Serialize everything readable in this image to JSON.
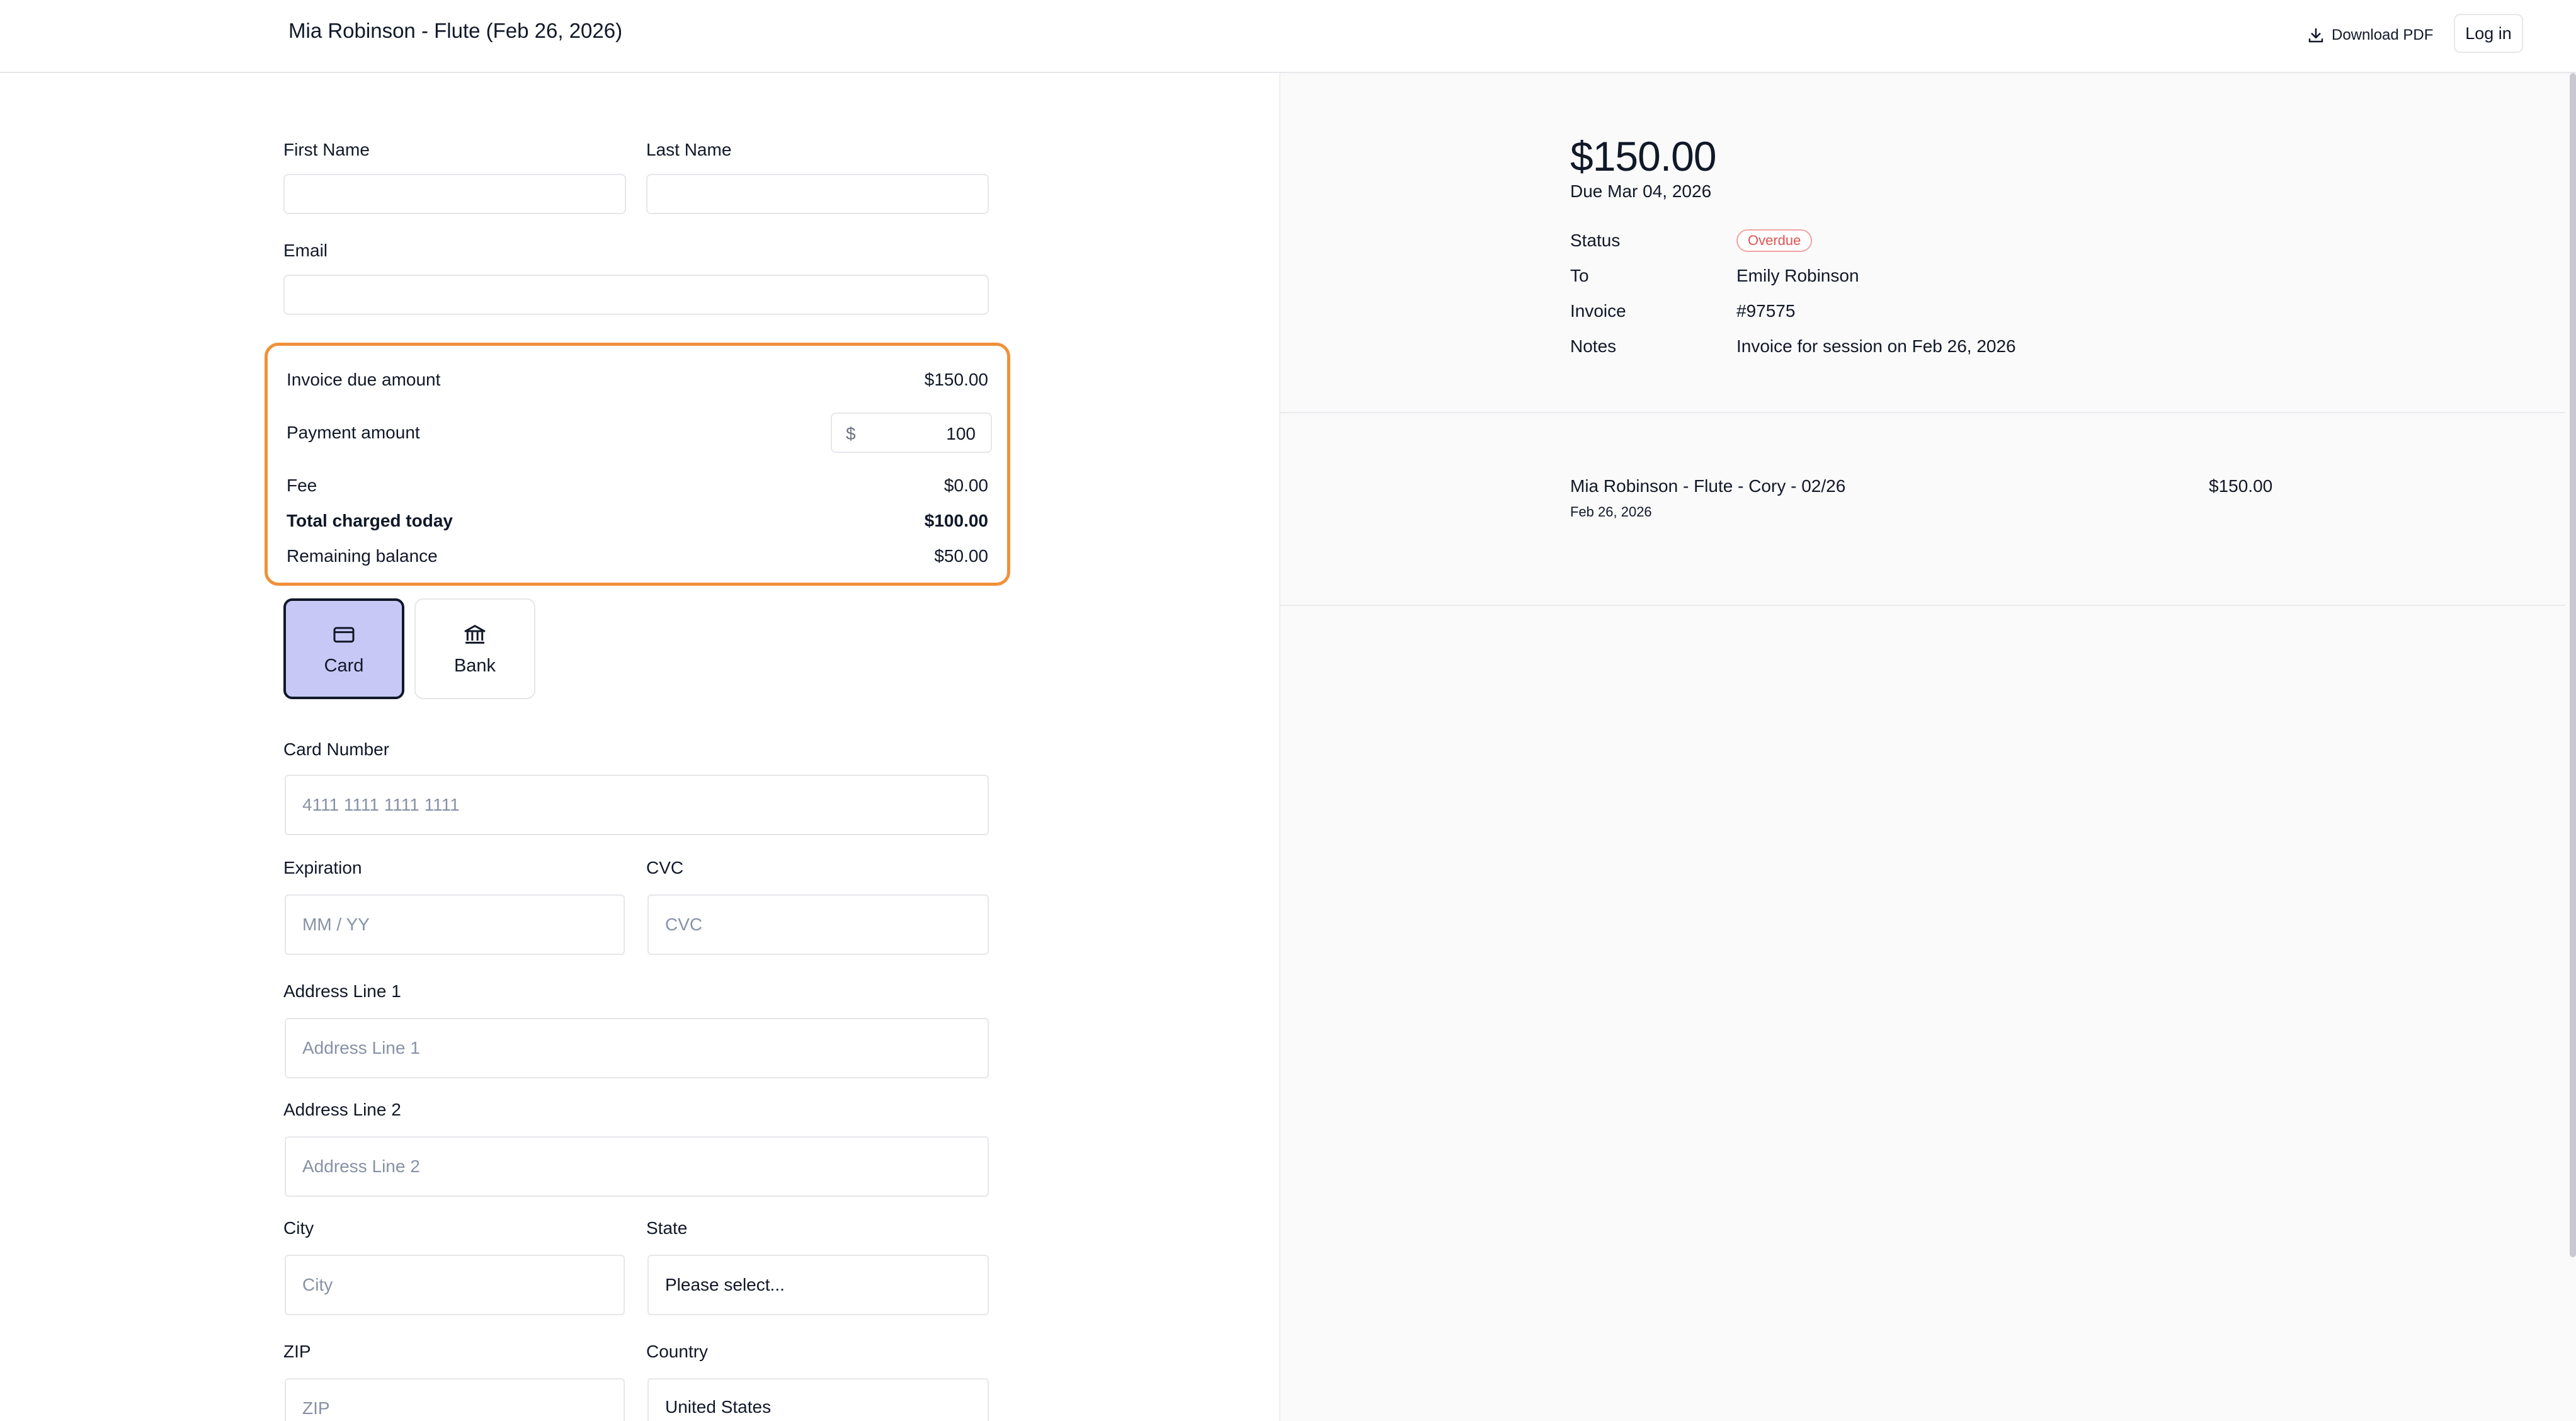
{
  "header": {
    "title": "Mia Robinson - Flute (Feb 26, 2026)",
    "download_label": "Download PDF",
    "login_label": "Log in"
  },
  "form": {
    "first_name_label": "First Name",
    "first_name_value": "",
    "last_name_label": "Last Name",
    "last_name_value": "",
    "email_label": "Email",
    "email_value": ""
  },
  "summary": {
    "due_label": "Invoice due amount",
    "due_value": "$150.00",
    "payment_label": "Payment amount",
    "payment_prefix": "$",
    "payment_value": "100",
    "fee_label": "Fee",
    "fee_value": "$0.00",
    "total_label": "Total charged today",
    "total_value": "$100.00",
    "remaining_label": "Remaining balance",
    "remaining_value": "$50.00"
  },
  "methods": {
    "card_label": "Card",
    "bank_label": "Bank",
    "selected": "Card"
  },
  "card": {
    "number_label": "Card Number",
    "number_placeholder": "4111 1111 1111 1111",
    "expiration_label": "Expiration",
    "expiration_placeholder": "MM / YY",
    "cvc_label": "CVC",
    "cvc_placeholder": "CVC",
    "address1_label": "Address Line 1",
    "address1_placeholder": "Address Line 1",
    "address2_label": "Address Line 2",
    "address2_placeholder": "Address Line 2",
    "city_label": "City",
    "city_placeholder": "City",
    "state_label": "State",
    "state_value": "Please select...",
    "zip_label": "ZIP",
    "zip_placeholder": "ZIP",
    "country_label": "Country",
    "country_value": "United States"
  },
  "invoice": {
    "amount": "$150.00",
    "due": "Due Mar 04, 2026",
    "status_label": "Status",
    "status_value": "Overdue",
    "to_label": "To",
    "to_value": "Emily Robinson",
    "invoice_label": "Invoice",
    "invoice_value": "#97575",
    "notes_label": "Notes",
    "notes_value": "Invoice for session on Feb 26, 2026",
    "line_item_title": "Mia Robinson - Flute - Cory - 02/26",
    "line_item_date": "Feb 26, 2026",
    "line_item_amount": "$150.00"
  },
  "colors": {
    "summary_border": "#f0913a",
    "card_selected_bg": "#c7c8f6",
    "status_red": "#e05252",
    "panel_bg": "#fafafb"
  },
  "icons": {
    "download": "download-icon",
    "card": "credit-card-icon",
    "bank": "bank-icon"
  }
}
